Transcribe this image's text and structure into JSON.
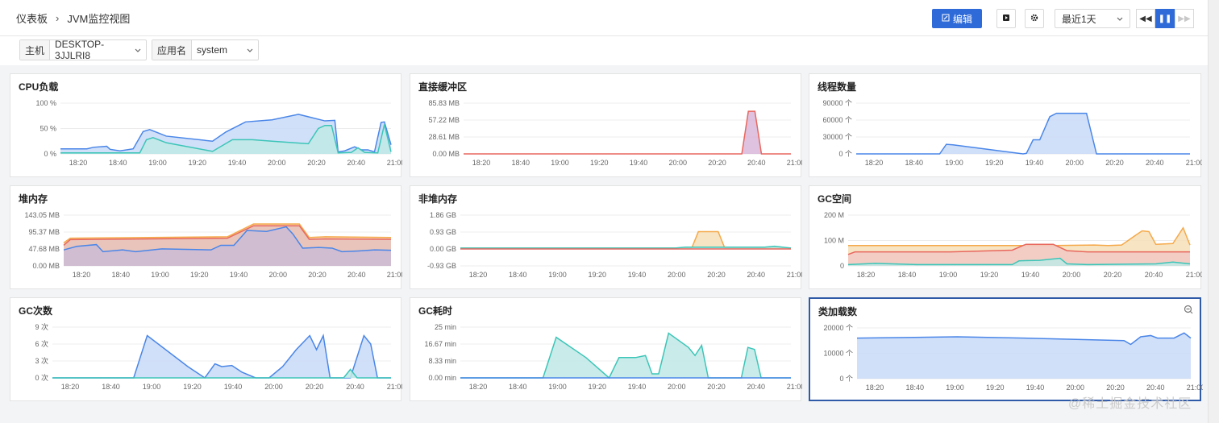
{
  "breadcrumb": {
    "root": "仪表板",
    "separator": "›",
    "current": "JVM监控视图"
  },
  "toolbar": {
    "edit_label": "编辑",
    "time_range": "最近1天"
  },
  "filters": [
    {
      "label": "主机",
      "value": "DESKTOP-3JJLRI8"
    },
    {
      "label": "应用名",
      "value": "system"
    }
  ],
  "watermark": "@稀土掘金技术社区",
  "colors": {
    "accent": "#2f6bd8",
    "blue": "#4a86e8",
    "teal": "#3cc5b8",
    "orange": "#f5a94a",
    "red": "#e8675e",
    "blue_fill": "#c9daf8",
    "teal_fill": "#bfe9e6"
  },
  "panels": [
    {
      "id": "cpu",
      "title": "CPU负载",
      "yticks": [
        "100 %",
        "50 %",
        "0 %"
      ],
      "ymax": 100,
      "series": [
        {
          "color": "#4a86e8",
          "fill": "#c9daf8",
          "values": [
            [
              0,
              10
            ],
            [
              8,
              10
            ],
            [
              10,
              13
            ],
            [
              14,
              15
            ],
            [
              15,
              9
            ],
            [
              18,
              6
            ],
            [
              22,
              10
            ],
            [
              25,
              44
            ],
            [
              27,
              48
            ],
            [
              32,
              35
            ],
            [
              46,
              25
            ],
            [
              50,
              43
            ],
            [
              56,
              63
            ],
            [
              64,
              67
            ],
            [
              72,
              78
            ],
            [
              80,
              65
            ],
            [
              83,
              66
            ],
            [
              84,
              4
            ],
            [
              86,
              6
            ],
            [
              89,
              14
            ],
            [
              91,
              8
            ],
            [
              93,
              8
            ],
            [
              95,
              4
            ],
            [
              97,
              62
            ],
            [
              98,
              63
            ],
            [
              100,
              18
            ]
          ]
        },
        {
          "color": "#3cc5b8",
          "fill": "#bfe9e6",
          "values": [
            [
              0,
              2
            ],
            [
              24,
              2
            ],
            [
              26,
              28
            ],
            [
              28,
              32
            ],
            [
              32,
              22
            ],
            [
              46,
              5
            ],
            [
              52,
              28
            ],
            [
              58,
              28
            ],
            [
              64,
              25
            ],
            [
              75,
              20
            ],
            [
              78,
              50
            ],
            [
              80,
              56
            ],
            [
              82,
              56
            ],
            [
              84,
              2
            ],
            [
              88,
              3
            ],
            [
              90,
              12
            ],
            [
              92,
              3
            ],
            [
              96,
              2
            ],
            [
              98,
              58
            ],
            [
              100,
              4
            ]
          ]
        }
      ]
    },
    {
      "id": "direct",
      "title": "直接缓冲区",
      "yticks": [
        "85.83 MB",
        "57.22 MB",
        "28.61 MB",
        "0.00 MB"
      ],
      "ymax": 85.83,
      "series": [
        {
          "color": "#e8675e",
          "fill": "#d9b7d9",
          "values": [
            [
              0,
              0
            ],
            [
              85,
              0
            ],
            [
              87,
              72
            ],
            [
              89,
              72
            ],
            [
              91,
              0
            ],
            [
              100,
              0
            ]
          ]
        }
      ]
    },
    {
      "id": "threads",
      "title": "线程数量",
      "yticks": [
        "90000 个",
        "60000 个",
        "30000 个",
        "0 个"
      ],
      "ymax": 90000,
      "series": [
        {
          "color": "#4a86e8",
          "fill": "#c9daf8",
          "values": [
            [
              0,
              0
            ],
            [
              25,
              0
            ],
            [
              27,
              17000
            ],
            [
              29,
              16000
            ],
            [
              50,
              0
            ],
            [
              51,
              1000
            ],
            [
              53,
              25000
            ],
            [
              55,
              25000
            ],
            [
              58,
              66000
            ],
            [
              60,
              72000
            ],
            [
              69,
              72000
            ],
            [
              72,
              0
            ],
            [
              100,
              0
            ]
          ]
        }
      ]
    },
    {
      "id": "heap",
      "title": "堆内存",
      "yticks": [
        "143.05 MB",
        "95.37 MB",
        "47.68 MB",
        "0.00 MB"
      ],
      "ymax": 143.05,
      "series": [
        {
          "color": "#f5a94a",
          "fill": "#f3d5b5",
          "values": [
            [
              0,
              65
            ],
            [
              2,
              78
            ],
            [
              12,
              79
            ],
            [
              50,
              82
            ],
            [
              58,
              118
            ],
            [
              72,
              118
            ],
            [
              75,
              80
            ],
            [
              80,
              82
            ],
            [
              100,
              80
            ]
          ]
        },
        {
          "color": "#e8675e",
          "fill": "#e6c0b8",
          "values": [
            [
              0,
              58
            ],
            [
              2,
              74
            ],
            [
              12,
              75
            ],
            [
              50,
              78
            ],
            [
              58,
              113
            ],
            [
              72,
              113
            ],
            [
              75,
              75
            ],
            [
              80,
              76
            ],
            [
              100,
              75
            ]
          ]
        },
        {
          "color": "#4a86e8",
          "fill": "#cbbcd6",
          "values": [
            [
              0,
              45
            ],
            [
              4,
              55
            ],
            [
              10,
              60
            ],
            [
              12,
              40
            ],
            [
              18,
              45
            ],
            [
              22,
              40
            ],
            [
              30,
              48
            ],
            [
              45,
              45
            ],
            [
              48,
              58
            ],
            [
              52,
              58
            ],
            [
              56,
              100
            ],
            [
              62,
              97
            ],
            [
              68,
              110
            ],
            [
              70,
              90
            ],
            [
              73,
              50
            ],
            [
              78,
              52
            ],
            [
              82,
              50
            ],
            [
              85,
              40
            ],
            [
              90,
              42
            ],
            [
              95,
              45
            ],
            [
              100,
              44
            ]
          ]
        }
      ]
    },
    {
      "id": "nonheap",
      "title": "非堆内存",
      "yticks": [
        "1.86 GB",
        "0.93 GB",
        "0.00 GB",
        "-0.93 GB"
      ],
      "ymin": -0.93,
      "ymax": 1.86,
      "series": [
        {
          "color": "#f5a94a",
          "fill": "#f6dfb8",
          "values": [
            [
              0,
              0.05
            ],
            [
              70,
              0.05
            ],
            [
              72,
              0.95
            ],
            [
              78,
              0.95
            ],
            [
              80,
              0.05
            ],
            [
              100,
              0.05
            ]
          ]
        },
        {
          "color": "#3cc5b8",
          "fill": "#bfe9e6",
          "values": [
            [
              0,
              0.05
            ],
            [
              65,
              0.05
            ],
            [
              68,
              0.1
            ],
            [
              92,
              0.1
            ],
            [
              95,
              0.15
            ],
            [
              100,
              0.05
            ]
          ]
        },
        {
          "color": "#e8675e",
          "fill": "none",
          "values": [
            [
              0,
              0
            ],
            [
              100,
              0
            ]
          ]
        }
      ]
    },
    {
      "id": "gcspace",
      "title": "GC空间",
      "yticks": [
        "200 M",
        "100 M",
        "0"
      ],
      "ymax": 200,
      "series": [
        {
          "color": "#f5a94a",
          "fill": "#f6dfb8",
          "values": [
            [
              0,
              80
            ],
            [
              60,
              80
            ],
            [
              72,
              82
            ],
            [
              76,
              80
            ],
            [
              80,
              82
            ],
            [
              84,
              120
            ],
            [
              86,
              138
            ],
            [
              88,
              135
            ],
            [
              90,
              85
            ],
            [
              95,
              88
            ],
            [
              98,
              150
            ],
            [
              100,
              82
            ]
          ]
        },
        {
          "color": "#e8675e",
          "fill": "#f2c9c4",
          "values": [
            [
              0,
              45
            ],
            [
              2,
              55
            ],
            [
              30,
              55
            ],
            [
              48,
              62
            ],
            [
              52,
              85
            ],
            [
              60,
              85
            ],
            [
              64,
              60
            ],
            [
              70,
              55
            ],
            [
              85,
              55
            ],
            [
              100,
              55
            ]
          ]
        },
        {
          "color": "#3cc5b8",
          "fill": "#bfe9e6",
          "values": [
            [
              0,
              5
            ],
            [
              8,
              10
            ],
            [
              20,
              5
            ],
            [
              48,
              5
            ],
            [
              50,
              20
            ],
            [
              56,
              22
            ],
            [
              62,
              30
            ],
            [
              64,
              8
            ],
            [
              70,
              5
            ],
            [
              90,
              8
            ],
            [
              95,
              15
            ],
            [
              100,
              8
            ]
          ]
        }
      ]
    },
    {
      "id": "gccount",
      "title": "GC次数",
      "yticks": [
        "9 次",
        "6 次",
        "3 次",
        "0 次"
      ],
      "ymax": 9,
      "series": [
        {
          "color": "#4a86e8",
          "fill": "#c9daf8",
          "values": [
            [
              0,
              0
            ],
            [
              24,
              0
            ],
            [
              28,
              7.5
            ],
            [
              40,
              2
            ],
            [
              45,
              0
            ],
            [
              48,
              2.5
            ],
            [
              50,
              2
            ],
            [
              53,
              2.2
            ],
            [
              56,
              1
            ],
            [
              60,
              0
            ],
            [
              64,
              0
            ],
            [
              68,
              2
            ],
            [
              72,
              5
            ],
            [
              76,
              7.5
            ],
            [
              78,
              5
            ],
            [
              80,
              7.5
            ],
            [
              82,
              0
            ],
            [
              88,
              0
            ],
            [
              92,
              7.5
            ],
            [
              94,
              6
            ],
            [
              96,
              0
            ],
            [
              100,
              0
            ]
          ]
        },
        {
          "color": "#3cc5b8",
          "fill": "#bfe9e6",
          "values": [
            [
              0,
              0
            ],
            [
              86,
              0
            ],
            [
              88,
              1.5
            ],
            [
              90,
              0
            ],
            [
              100,
              0
            ]
          ]
        }
      ]
    },
    {
      "id": "gctime",
      "title": "GC耗时",
      "yticks": [
        "25 min",
        "16.67 min",
        "8.33 min",
        "0.00 min"
      ],
      "ymax": 25,
      "series": [
        {
          "color": "#3cc5b8",
          "fill": "#bfe9e6",
          "values": [
            [
              0,
              0
            ],
            [
              25,
              0
            ],
            [
              29,
              20
            ],
            [
              38,
              10
            ],
            [
              45,
              0
            ],
            [
              48,
              10
            ],
            [
              50,
              10
            ],
            [
              53,
              10
            ],
            [
              56,
              11
            ],
            [
              58,
              2
            ],
            [
              60,
              2
            ],
            [
              63,
              22
            ],
            [
              69,
              15
            ],
            [
              71,
              11
            ],
            [
              73,
              16
            ],
            [
              75,
              0
            ],
            [
              85,
              0
            ],
            [
              87,
              15
            ],
            [
              89,
              14
            ],
            [
              91,
              0
            ],
            [
              100,
              0
            ]
          ]
        },
        {
          "color": "#4a86e8",
          "fill": "none",
          "values": [
            [
              0,
              0
            ],
            [
              100,
              0
            ]
          ]
        }
      ]
    },
    {
      "id": "classload",
      "title": "类加载数",
      "yticks": [
        "20000 个",
        "10000 个",
        "0 个"
      ],
      "ymax": 20000,
      "selected": true,
      "series": [
        {
          "color": "#4a86e8",
          "fill": "#c9daf8",
          "values": [
            [
              0,
              16000
            ],
            [
              30,
              16500
            ],
            [
              50,
              16000
            ],
            [
              80,
              15000
            ],
            [
              82,
              13500
            ],
            [
              85,
              16500
            ],
            [
              88,
              17000
            ],
            [
              90,
              16000
            ],
            [
              95,
              16000
            ],
            [
              98,
              18000
            ],
            [
              100,
              16000
            ]
          ]
        }
      ]
    }
  ],
  "xticks_main": [
    "18:20",
    "18:40",
    "19:00",
    "19:20",
    "19:40",
    "20:00",
    "20:20",
    "20:40",
    "21:00"
  ]
}
